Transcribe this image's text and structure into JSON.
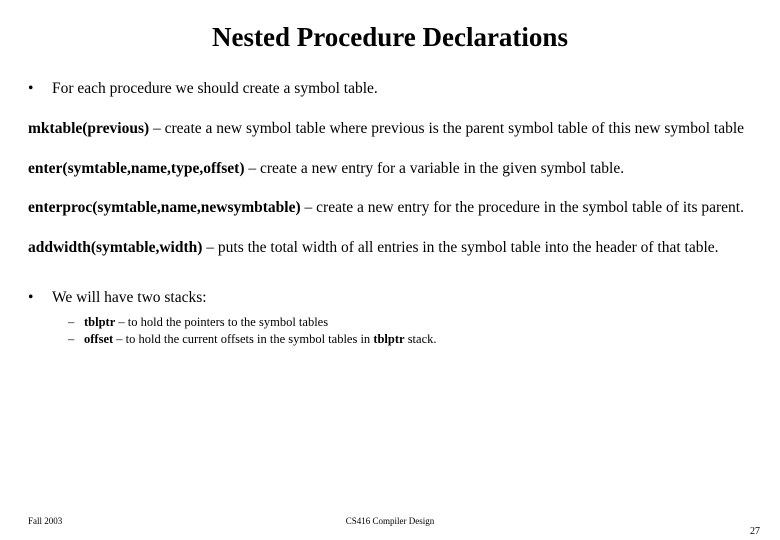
{
  "title": "Nested Procedure Declarations",
  "bullets": {
    "b1": "For each procedure we should create a symbol table.",
    "b2": "We will have two stacks:"
  },
  "paras": {
    "p1_lead": "mktable(previous)",
    "p1_rest": " – create a new symbol table where previous is the parent symbol table of this new symbol table",
    "p2_lead": "enter(symtable,name,type,offset)",
    "p2_rest": " – create a new entry for a variable in the given symbol table.",
    "p3_lead": "enterproc(symtable,name,newsymbtable)",
    "p3_rest": " – create a new entry for the procedure in the symbol table of its parent.",
    "p4_lead": "addwidth(symtable,width)",
    "p4_rest": " – puts the total width of all entries in the symbol table into the header of that table."
  },
  "sub": {
    "s1_lead": "tblptr",
    "s1_rest": " – to hold the pointers to the symbol tables",
    "s2_lead": "offset",
    "s2_rest_a": " – to hold the current offsets in the symbol tables in ",
    "s2_bold": "tblptr",
    "s2_rest_b": " stack."
  },
  "footer": {
    "left": "Fall 2003",
    "center": "CS416 Compiler Design",
    "right": "27"
  },
  "marks": {
    "bullet": "•",
    "dash": "–"
  }
}
